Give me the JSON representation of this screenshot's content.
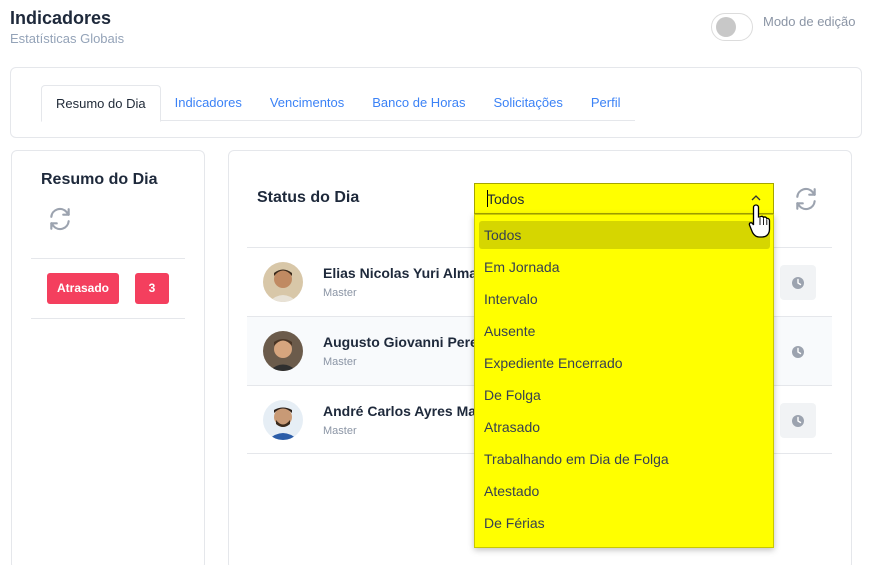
{
  "header": {
    "title": "Indicadores",
    "subtitle": "Estatísticas Globais",
    "edit_mode_label": "Modo de edição"
  },
  "tabs": [
    {
      "label": "Resumo do Dia",
      "active": true
    },
    {
      "label": "Indicadores"
    },
    {
      "label": "Vencimentos"
    },
    {
      "label": "Banco de Horas"
    },
    {
      "label": "Solicitações"
    },
    {
      "label": "Perfil"
    }
  ],
  "summary": {
    "title": "Resumo do Dia",
    "status_label": "Atrasado",
    "status_count": "3",
    "icon": "refresh-icon"
  },
  "status_panel": {
    "title": "Status do Dia",
    "filter": {
      "selected": "Todos",
      "options": [
        "Todos",
        "Em Jornada",
        "Intervalo",
        "Ausente",
        "Expediente Encerrado",
        "De Folga",
        "Atrasado",
        "Trabalhando em Dia de Folga",
        "Atestado",
        "De Férias"
      ]
    },
    "employees": [
      {
        "name": "Elias Nicolas Yuri Alma",
        "role": "Master"
      },
      {
        "name": "Augusto Giovanni Pere",
        "role": "Master"
      },
      {
        "name": "André Carlos Ayres Ma",
        "role": "Master"
      }
    ]
  },
  "colors": {
    "accent": "#3b82f6",
    "badge": "#f43f5e",
    "dropdown_bg": "#ffff00",
    "dropdown_selected": "#d6d600"
  }
}
